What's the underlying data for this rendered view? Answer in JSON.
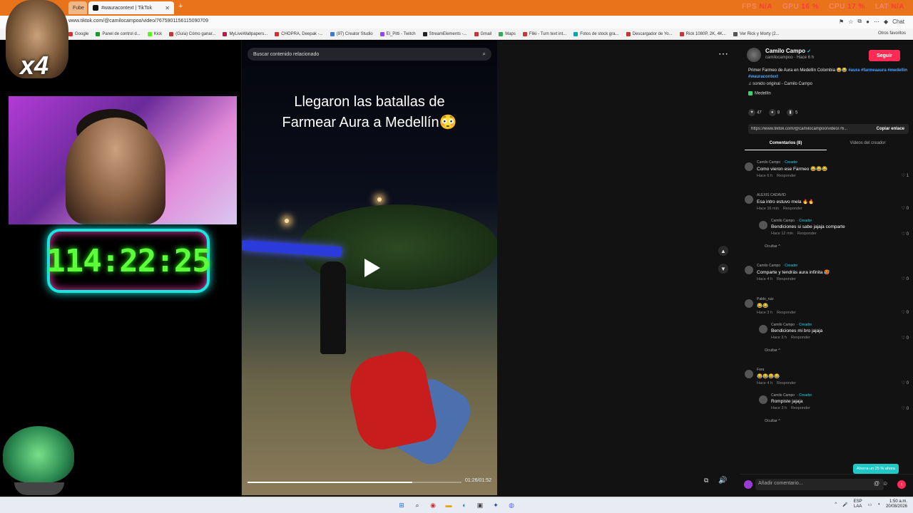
{
  "browser": {
    "tab_left": "Fube",
    "tab_active": "#wauracontext | TikTok",
    "url": "www.tiktok.com/@camilocampoo/video/7675901156115090709",
    "stats": [
      {
        "k": "FPS",
        "v": "N/A"
      },
      {
        "k": "GPU",
        "v": "16 %"
      },
      {
        "k": "CPU",
        "v": "17 %"
      },
      {
        "k": "LAT",
        "v": "N/A"
      }
    ],
    "chat": "Chat",
    "bookmarks": [
      "Google",
      "Panel de control d...",
      "Kick",
      "(Guía) Cómo ganar...",
      "MyLiveWallpapers...",
      "CHOPRA, Deepak -...",
      "(97) Creator Studio",
      "El_Pitti - Twitch",
      "StreamElements -...",
      "Gmail",
      "Maps",
      "Fliki - Turn text int...",
      "Fotos de stock gra...",
      "Descargador de Yo...",
      "Rick 1080P, 2K, 4K...",
      "Ver Rick y Morty (2..."
    ],
    "other_bookmarks": "Otros favoritos"
  },
  "overlay": {
    "multiplier": "x4",
    "timer": "114:22:25"
  },
  "video": {
    "search_placeholder": "Buscar contenido relacionado",
    "caption_line1": "Llegaron las batallas de",
    "caption_line2": "Farmear Aura a Medellín😳",
    "time": "01:26/01:52",
    "progress": 0.77
  },
  "post": {
    "author": "Camilo Campo",
    "handle_time": "camilocampoo · Hace 6 h",
    "follow": "Seguir",
    "desc_text": "Primer Farmeo de Aura en Medellín Colombia 😂😂 ",
    "desc_tags": "#aura #farmeaaura #medellin #wauracontext",
    "sound": "♫ sonido original - Camilo Campo",
    "location": "Medellín",
    "likes": "47",
    "comments_count": "8",
    "saves": "5",
    "link": "https://www.tiktok.com/@camilocampoo/video/76...",
    "copy_link": "Copiar enlace",
    "tab_comments": "Comentarios (8)",
    "tab_videos": "Videos del creador"
  },
  "comments": [
    {
      "name": "Camilo Campo",
      "creator": "· Creador",
      "text": "Como vieron ese Farmeo 😂😂😂",
      "time": "Hace 6 h",
      "reply": "Responder",
      "likes": "1"
    },
    {
      "name": "ALEXIS CADAVID",
      "creator": "",
      "text": "Esa intro estuvo mela 🔥🔥",
      "time": "Hace 16 min",
      "reply": "Responder",
      "likes": "0"
    },
    {
      "name": "Camilo Campo",
      "creator": "· Creador",
      "text": "Bendiciones si sabe jajaja comparte",
      "time": "Hace 12 min",
      "reply": "Responder",
      "likes": "0",
      "indent": true
    },
    {
      "hide": "Ocultar ^"
    },
    {
      "name": "Camilo Campo",
      "creator": "· Creador",
      "text": "Comparte y tendrás aura infinita 🥵",
      "time": "Hace 4 h",
      "reply": "Responder",
      "likes": "0"
    },
    {
      "name": "Pablo_ruiz",
      "creator": "",
      "text": "😂😂",
      "time": "Hace 3 h",
      "reply": "Responder",
      "likes": "0"
    },
    {
      "name": "Camilo Campo",
      "creator": "· Creador",
      "text": "Bendiciones mi bro jajaja",
      "time": "Hace 3 h",
      "reply": "Responder",
      "likes": "0",
      "indent": true
    },
    {
      "hide": "Ocultar ^"
    },
    {
      "name": "Fara",
      "creator": "",
      "text": "😂😂😂😂",
      "time": "Hace 4 h",
      "reply": "Responder",
      "likes": "0"
    },
    {
      "name": "Camilo Campo",
      "creator": "· Creador",
      "text": "Rompiste jajaja",
      "time": "Hace 3 h",
      "reply": "Responder",
      "likes": "0",
      "indent": true
    },
    {
      "hide": "Ocultar ^"
    }
  ],
  "promo": "Ahorra un 25 % ahora",
  "comment_input_placeholder": "Añadir comentario...",
  "taskbar": {
    "lang1": "ESP",
    "lang2": "LAA",
    "time": "1:50 a.m.",
    "date": "20/08/2026"
  },
  "colors": {
    "accent": "#fe2c55",
    "creator": "#20d5ec",
    "timer": "#5dff3a"
  }
}
